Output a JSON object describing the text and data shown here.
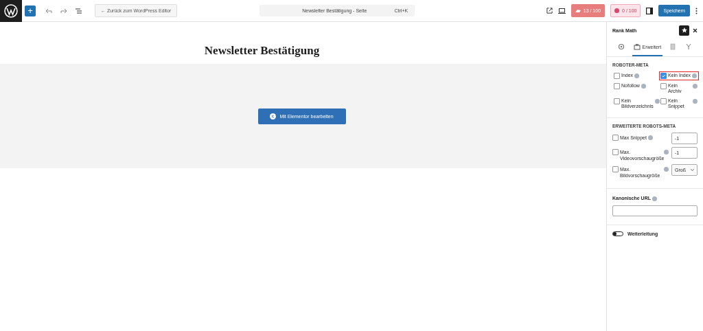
{
  "topbar": {
    "add_button": "+",
    "back_button": "← Zurück zum WordPress Editor",
    "command_bar": {
      "title": "Newsletter Bestätigung - Seite",
      "shortcut": "Ctrl+K"
    },
    "seo_score": "13 / 100",
    "readability_score": "0 / 100",
    "save_button": "Speichern"
  },
  "editor": {
    "page_title": "Newsletter Bestätigung",
    "elementor_button": "Mit Elementor bearbeiten"
  },
  "sidebar": {
    "title": "Rank Math",
    "tabs": [
      {
        "kind": "gear",
        "selected": false
      },
      {
        "kind": "toolbox",
        "label": "Erweitert",
        "selected": true
      },
      {
        "kind": "document",
        "selected": false
      },
      {
        "kind": "branch",
        "selected": false
      }
    ],
    "robots_meta": {
      "heading": "ROBOTER-META",
      "options": [
        {
          "label": "Index",
          "checked": false,
          "highlighted": false
        },
        {
          "label": "Kein Index",
          "checked": true,
          "highlighted": true
        },
        {
          "label": "Nofollow",
          "checked": false,
          "highlighted": false
        },
        {
          "label": "Kein Archiv",
          "checked": false,
          "highlighted": false
        },
        {
          "label": "Kein Bildverzeichnis",
          "checked": false,
          "highlighted": false
        },
        {
          "label": "Kein Snippet",
          "checked": false,
          "highlighted": false
        }
      ]
    },
    "advanced_robots_meta": {
      "heading": "ERWEITERTE ROBOTS-META",
      "rows": [
        {
          "kind": "input",
          "label": "Max Snippet",
          "checked": false,
          "value": "-1"
        },
        {
          "kind": "input",
          "label": "Max. Videovorschaugröße",
          "checked": false,
          "value": "-1"
        },
        {
          "kind": "select",
          "label": "Max. Bildvorschaugröße",
          "checked": false,
          "value": "Groß"
        }
      ]
    },
    "canonical_url": {
      "label": "Kanonische URL"
    },
    "redirect": {
      "label": "Weiterleitung",
      "on": false
    }
  }
}
